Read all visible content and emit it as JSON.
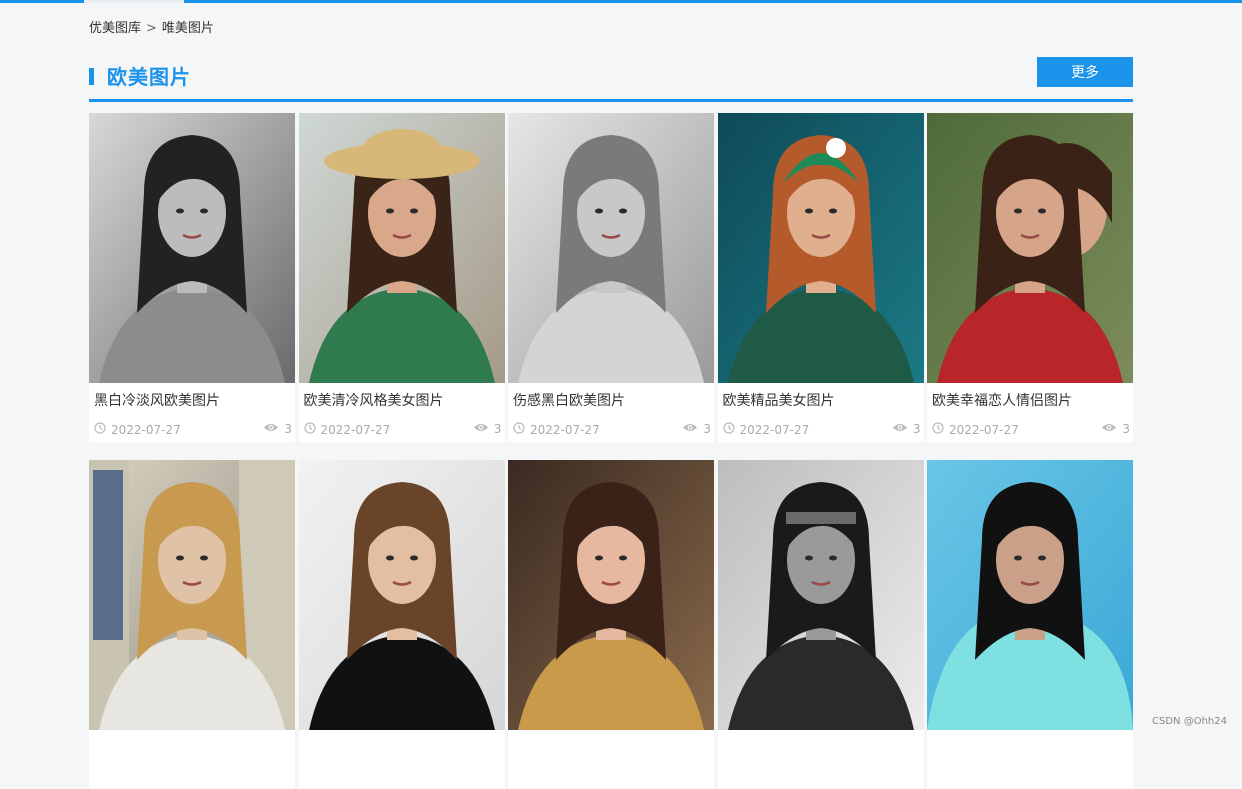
{
  "breadcrumb": {
    "home": "优美图库",
    "separator": ">",
    "current": "唯美图片"
  },
  "section": {
    "title": "欧美图片",
    "more_label": "更多"
  },
  "colors": {
    "accent": "#1c93ea",
    "page_bg": "#f4f6f8",
    "meta_gray": "#aaaaaa"
  },
  "cards": [
    {
      "title": "黑白冷淡风欧美图片",
      "date": "2022-07-27",
      "views": "3",
      "tone": "mono"
    },
    {
      "title": "欧美清冷风格美女图片",
      "date": "2022-07-27",
      "views": "3",
      "tone": "green"
    },
    {
      "title": "伤感黑白欧美图片",
      "date": "2022-07-27",
      "views": "3",
      "tone": "mono-light"
    },
    {
      "title": "欧美精品美女图片",
      "date": "2022-07-27",
      "views": "3",
      "tone": "teal"
    },
    {
      "title": "欧美幸福恋人情侣图片",
      "date": "2022-07-27",
      "views": "3",
      "tone": "red"
    },
    {
      "title": "",
      "date": "",
      "views": "",
      "tone": "stone"
    },
    {
      "title": "",
      "date": "",
      "views": "",
      "tone": "white"
    },
    {
      "title": "",
      "date": "",
      "views": "",
      "tone": "warm"
    },
    {
      "title": "",
      "date": "",
      "views": "",
      "tone": "gray"
    },
    {
      "title": "",
      "date": "",
      "views": "",
      "tone": "aqua"
    }
  ],
  "icons": {
    "date": "clock-icon",
    "views": "eye-icon"
  },
  "watermark": "CSDN @Ohh24"
}
